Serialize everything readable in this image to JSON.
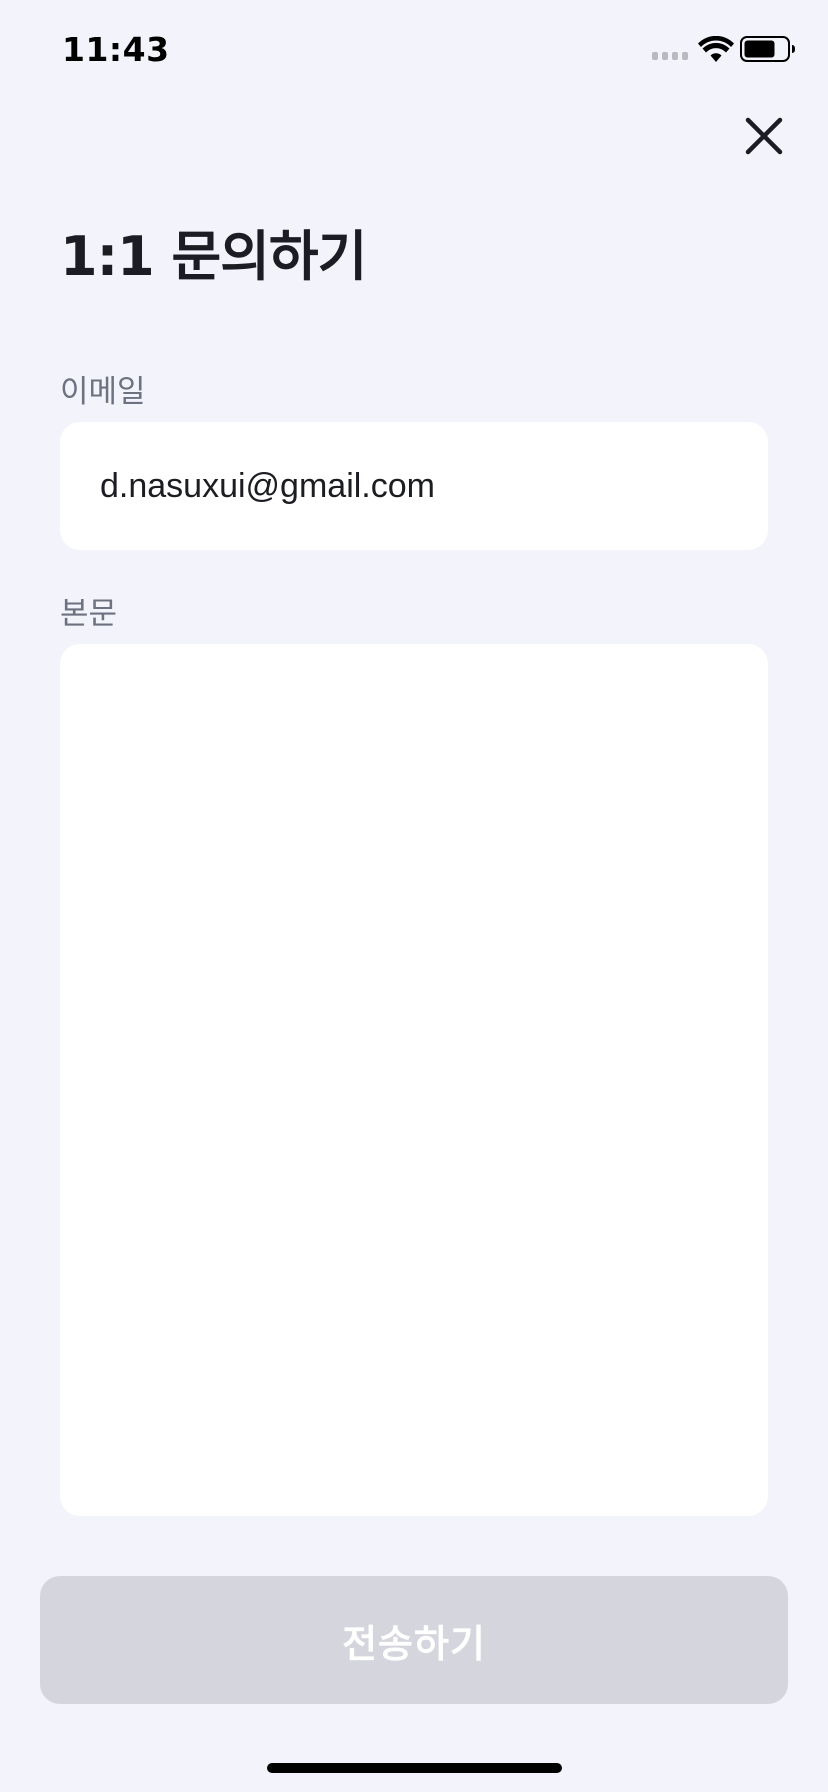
{
  "status_bar": {
    "time": "11:43",
    "signal_icon": "cellular-signal-icon",
    "wifi_icon": "wifi-icon",
    "battery_icon": "battery-icon"
  },
  "header": {
    "close_icon": "close-icon",
    "title": "1:1 문의하기"
  },
  "form": {
    "email_label": "이메일",
    "email_value": "d.nasuxui@gmail.com",
    "body_label": "본문",
    "body_value": ""
  },
  "submit": {
    "label": "전송하기",
    "enabled": false
  },
  "colors": {
    "background": "#f3f3fb",
    "field_background": "#ffffff",
    "label_text": "#6c7280",
    "disabled_button": "#d5d5de"
  }
}
